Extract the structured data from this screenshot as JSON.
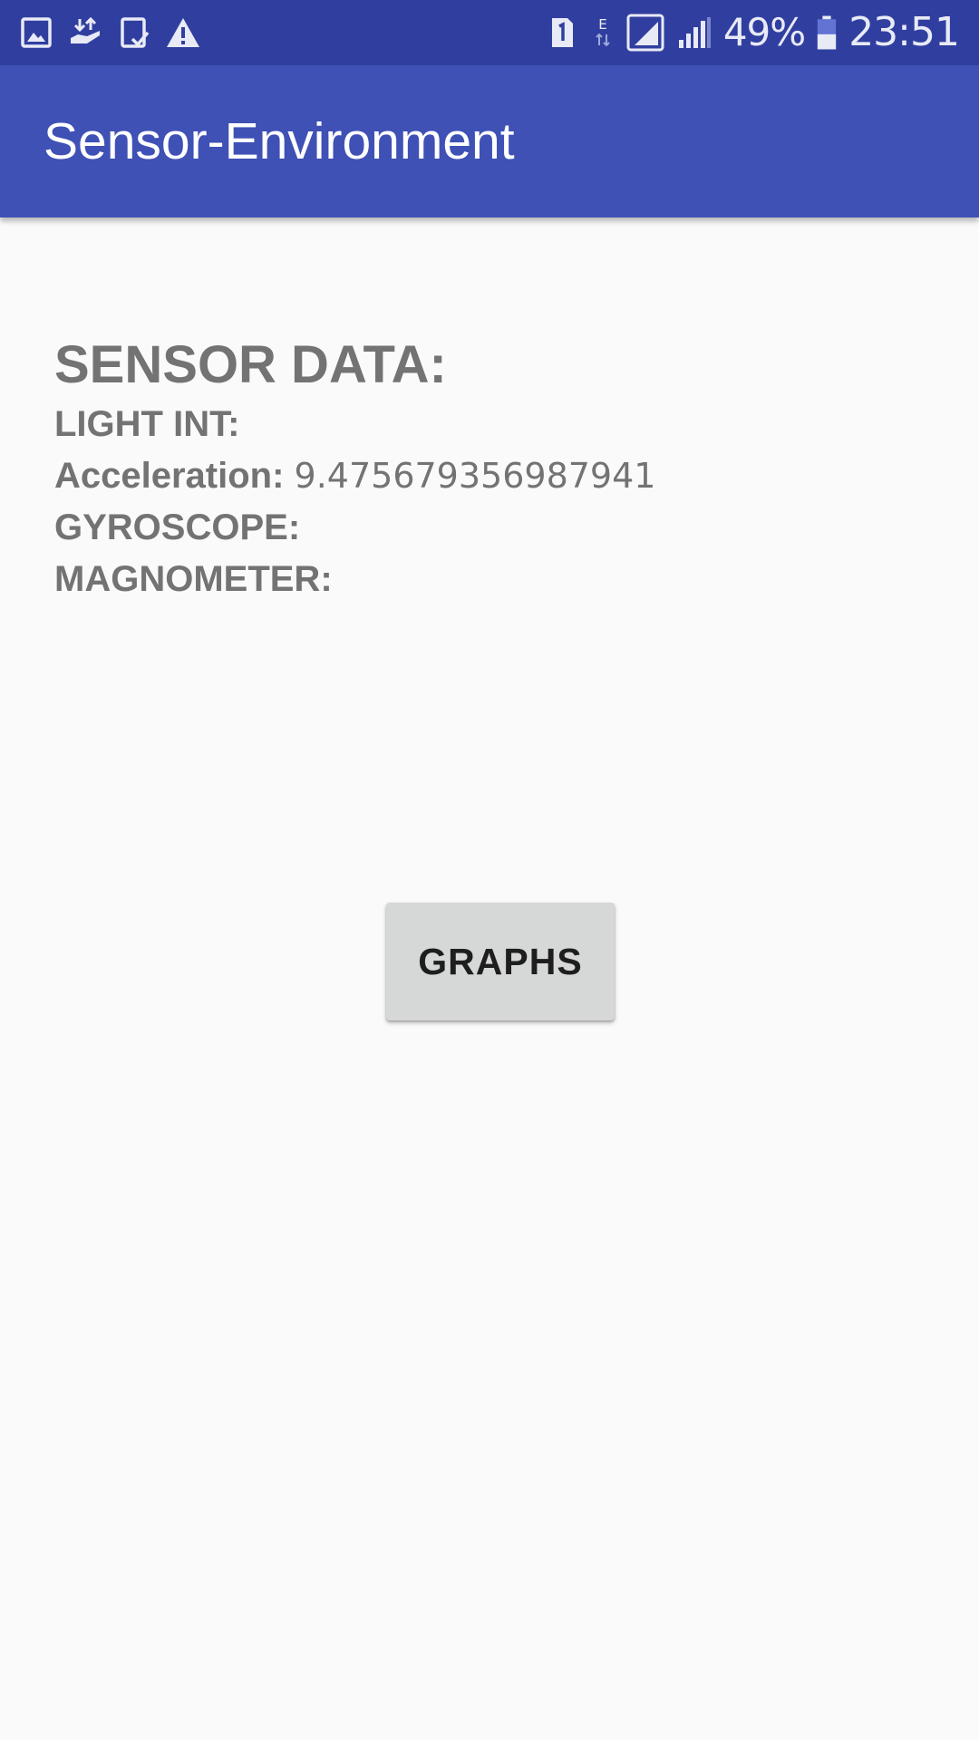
{
  "status_bar": {
    "left_icons": [
      "gallery-icon",
      "download-icon",
      "tablet-check-icon",
      "warning-icon"
    ],
    "right_icons": [
      "sim-1-icon",
      "data-e-icon",
      "signal-box-icon",
      "signal-icon",
      "battery-icon"
    ],
    "battery_percent": "49%",
    "time": "23:51"
  },
  "app_bar": {
    "title": "Sensor-Environment"
  },
  "sensor": {
    "heading": "SENSOR DATA:",
    "light_label": "LIGHT INT:",
    "acceleration_label": "Acceleration:",
    "acceleration_value": "9.475679356987941",
    "gyroscope_label": "GYROSCOPE:",
    "magnometer_label": "MAGNOMETER:"
  },
  "actions": {
    "graphs_label": "GRAPHS"
  },
  "colors": {
    "status_bar": "#303f9f",
    "app_bar": "#3f51b5",
    "background": "#fafafa",
    "text_gray": "#737373",
    "button": "#d6d7d7"
  }
}
